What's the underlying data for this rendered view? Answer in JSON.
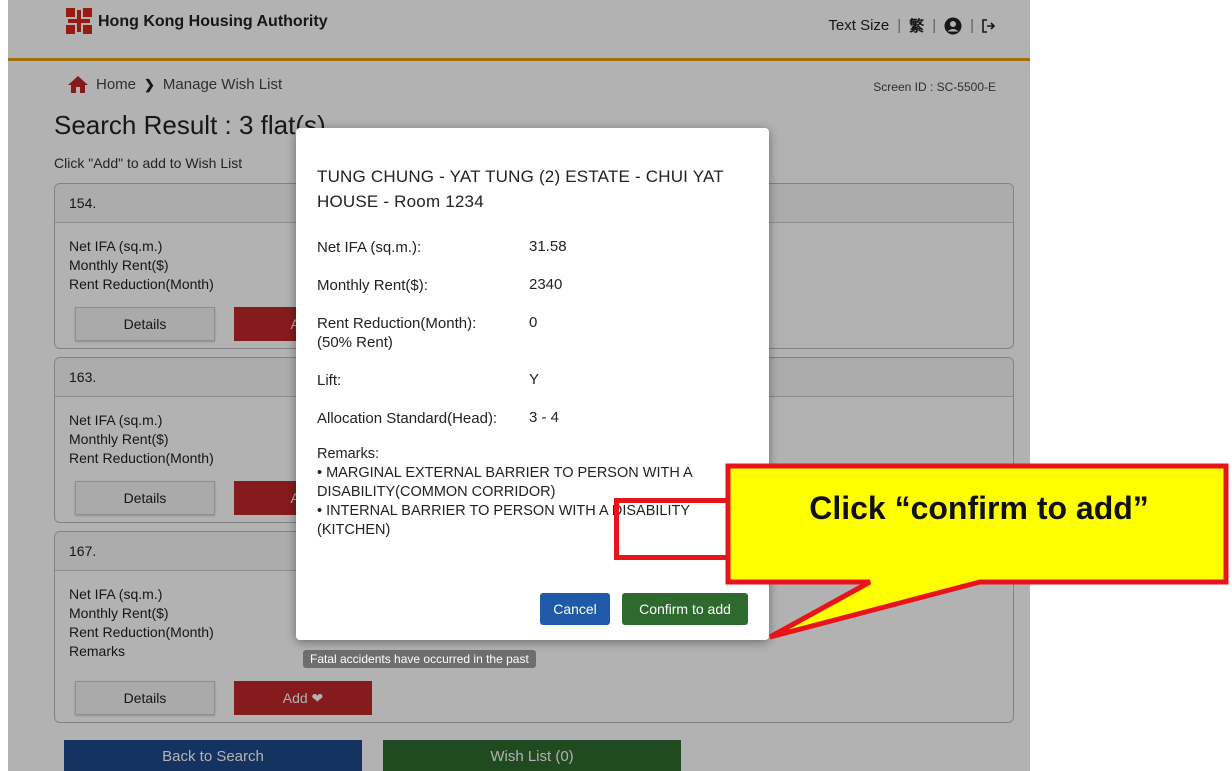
{
  "header": {
    "brand": "Hong Kong Housing Authority",
    "text_size": "Text Size",
    "lang": "繁"
  },
  "breadcrumb": {
    "home": "Home",
    "sep": "❯",
    "current": "Manage Wish List"
  },
  "screen_id": "Screen ID : SC-5500-E",
  "page": {
    "title": "Search Result : 3 flat(s)",
    "instruction": "Click \"Add\" to add to Wish List"
  },
  "cards": [
    {
      "number": "154.",
      "labels": [
        "Net IFA (sq.m.)",
        "Monthly Rent($)",
        "Rent Reduction(Month)"
      ],
      "details": "Details",
      "add": "Add"
    },
    {
      "number": "163.",
      "labels": [
        "Net IFA (sq.m.)",
        "Monthly Rent($)",
        "Rent Reduction(Month)"
      ],
      "details": "Details",
      "add": "Add"
    },
    {
      "number": "167.",
      "labels": [
        "Net IFA (sq.m.)",
        "Monthly Rent($)",
        "Rent Reduction(Month)",
        "Remarks"
      ],
      "details": "Details",
      "add": "Add ❤"
    }
  ],
  "tooltip": "Fatal accidents have occurred in the past",
  "bottom": {
    "back": "Back to Search",
    "wishlist": "Wish List (0)"
  },
  "modal": {
    "title": "TUNG CHUNG - YAT TUNG (2) ESTATE - CHUI YAT HOUSE - Room 1234",
    "net_ifa_label": "Net IFA (sq.m.):",
    "net_ifa": "31.58",
    "rent_label": "Monthly Rent($):",
    "rent": "2340",
    "reduction_label": "Rent Reduction(Month):",
    "reduction_sub": "(50% Rent)",
    "reduction": "0",
    "lift_label": "Lift:",
    "lift": "Y",
    "alloc_label": "Allocation Standard(Head):",
    "alloc": "3 - 4",
    "remarks_label": "Remarks:",
    "remark_1": "•  MARGINAL EXTERNAL BARRIER TO PERSON WITH A DISABILITY(COMMON CORRIDOR)",
    "remark_2": "•  INTERNAL BARRIER TO PERSON WITH A DISABILITY (KITCHEN)",
    "cancel": "Cancel",
    "confirm": "Confirm to add"
  },
  "callout": {
    "text": "Click “confirm to add”"
  },
  "colors": {
    "accent_orange": "#e8a015",
    "add_red": "#c0282a",
    "confirm_green": "#2e6a2e",
    "cancel_blue": "#1e5aa8",
    "callout_yellow": "#ffff00",
    "highlight_red": "#e8141a"
  }
}
